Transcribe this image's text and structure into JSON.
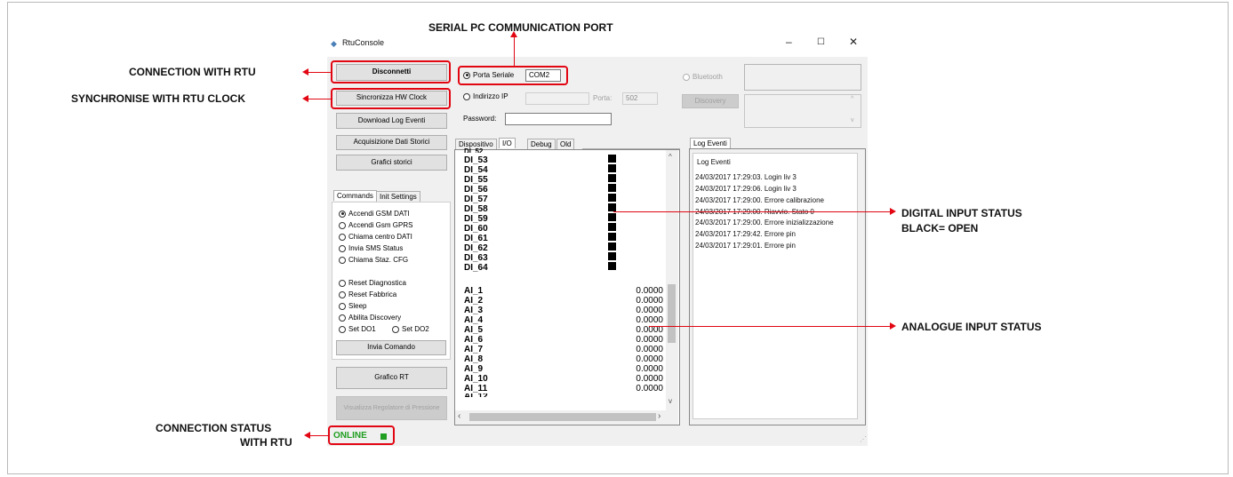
{
  "window": {
    "title": "RtuConsole",
    "minimize": "–",
    "maximize": "☐",
    "close": "✕"
  },
  "left_buttons": {
    "disconnect": "Disconnetti",
    "sync_clock": "Sincronizza HW Clock",
    "download_log": "Download Log Eventi",
    "acquire_history": "Acquisizione Dati Storici",
    "history_charts": "Grafici storici",
    "rt_chart": "Grafico RT",
    "pressure_regulator": "Visualizza Regolatore di Pressione"
  },
  "connection": {
    "serial_label": "Porta Seriale",
    "serial_value": "COM2",
    "ip_label": "Indirizzo IP",
    "port_label": "Porta:",
    "port_value": "502",
    "password_label": "Password:",
    "bluetooth_label": "Bluetooth",
    "discovery_label": "Discovery"
  },
  "command_tabs": [
    "Commands",
    "Init Settings"
  ],
  "commands": [
    {
      "label": "Accendi GSM DATI",
      "selected": true
    },
    {
      "label": "Accendi Gsm GPRS",
      "selected": false
    },
    {
      "label": "Chiama centro DATI",
      "selected": false
    },
    {
      "label": "Invia SMS Status",
      "selected": false
    },
    {
      "label": "Chiama Staz. CFG",
      "selected": false
    },
    {
      "label": "Reset Diagnostica",
      "selected": false
    },
    {
      "label": "Reset Fabbrica",
      "selected": false
    },
    {
      "label": "Sleep",
      "selected": false
    },
    {
      "label": "Abilita Discovery",
      "selected": false
    },
    {
      "label": "Set DO1",
      "selected": false
    },
    {
      "label": "Set DO2",
      "selected": false
    }
  ],
  "send_command": "Invia Comando",
  "io_tabs": [
    "Dispositivo",
    "I/O",
    "Debug",
    "Old"
  ],
  "digital_inputs": [
    "DI_53",
    "DI_54",
    "DI_55",
    "DI_56",
    "DI_57",
    "DI_58",
    "DI_59",
    "DI_60",
    "DI_61",
    "DI_62",
    "DI_63",
    "DI_64"
  ],
  "analog_inputs": [
    {
      "name": "AI_1",
      "value": "0.0000"
    },
    {
      "name": "AI_2",
      "value": "0.0000"
    },
    {
      "name": "AI_3",
      "value": "0.0000"
    },
    {
      "name": "AI_4",
      "value": "0.0000"
    },
    {
      "name": "AI_5",
      "value": "0.0000"
    },
    {
      "name": "AI_6",
      "value": "0.0000"
    },
    {
      "name": "AI_7",
      "value": "0.0000"
    },
    {
      "name": "AI_8",
      "value": "0.0000"
    },
    {
      "name": "AI_9",
      "value": "0.0000"
    },
    {
      "name": "AI_10",
      "value": "0.0000"
    },
    {
      "name": "AI_11",
      "value": "0.0000"
    }
  ],
  "log": {
    "tab": "Log Eventi",
    "header": "Log Eventi",
    "entries": [
      "24/03/2017 17:29:03. Login liv 3",
      "24/03/2017 17:29:06. Login liv 3",
      "24/03/2017 17:29:00. Errore calibrazione",
      "24/03/2017 17:29:00. Riavvio. Stato 0",
      "24/03/2017 17:29:00. Errore inizializzazione",
      "24/03/2017 17:29:42. Errore pin",
      "24/03/2017 17:29:01. Errore pin"
    ]
  },
  "status": {
    "text": "ONLINE",
    "color": "#1f9e1f"
  },
  "annotations": {
    "serial_port": "SERIAL PC COMMUNICATION PORT",
    "connection": "CONNECTION WITH RTU",
    "sync": "SYNCHRONISE WITH RTU CLOCK",
    "digital_1": "DIGITAL INPUT STATUS",
    "digital_2": "BLACK= OPEN",
    "analog": "ANALOGUE INPUT STATUS",
    "status_1": "CONNECTION STATUS",
    "status_2": "WITH RTU"
  },
  "colors": {
    "annotation_red": "#e20613",
    "online_green": "#1f9e1f"
  }
}
